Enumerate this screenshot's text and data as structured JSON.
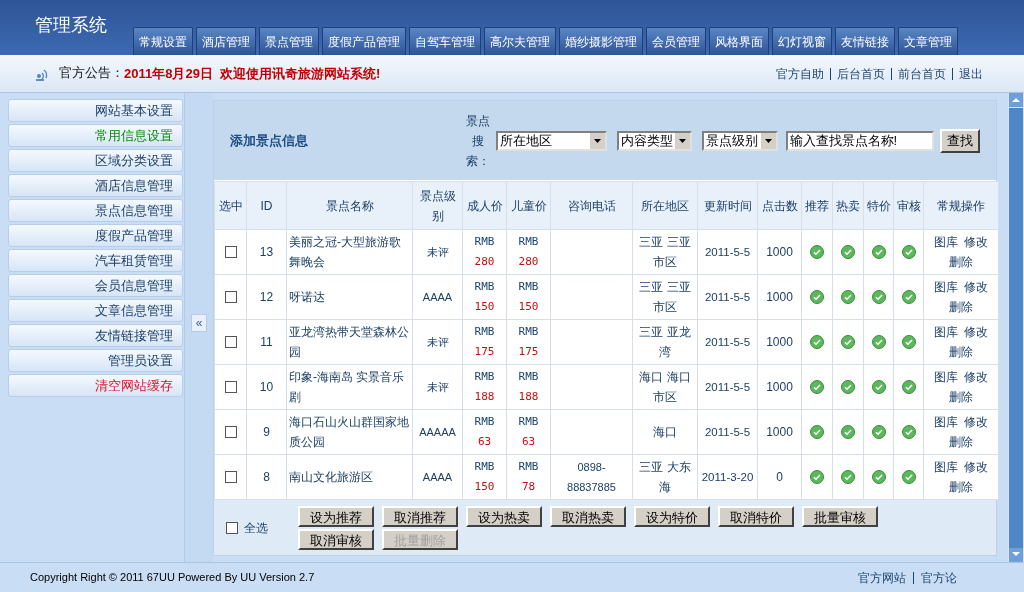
{
  "header": {
    "title": "管理系统",
    "tabs": [
      {
        "label": "常规设置"
      },
      {
        "label": "酒店管理"
      },
      {
        "label": "景点管理"
      },
      {
        "label": "度假产品管理"
      },
      {
        "label": "自驾车管理"
      },
      {
        "label": "高尔夫管理"
      },
      {
        "label": "婚纱摄影管理"
      },
      {
        "label": "会员管理"
      },
      {
        "label": "风格界面"
      },
      {
        "label": "幻灯视窗"
      },
      {
        "label": "友情链接"
      },
      {
        "label": "文章管理"
      }
    ]
  },
  "notice": {
    "label": "官方公告：",
    "text": "2011年8月29日  欢迎使用讯奇旅游网站系统!",
    "links": [
      "官方自助",
      "后台首页",
      "前台首页",
      "退出"
    ]
  },
  "sidebar": {
    "items": [
      {
        "label": "网站基本设置",
        "selected": false,
        "kind": "normal"
      },
      {
        "label": "常用信息设置",
        "selected": true,
        "kind": "normal"
      },
      {
        "label": "区域分类设置",
        "selected": false,
        "kind": "normal"
      },
      {
        "label": "酒店信息管理",
        "selected": false,
        "kind": "normal"
      },
      {
        "label": "景点信息管理",
        "selected": false,
        "kind": "normal"
      },
      {
        "label": "度假产品管理",
        "selected": false,
        "kind": "normal"
      },
      {
        "label": "汽车租赁管理",
        "selected": false,
        "kind": "normal"
      },
      {
        "label": "会员信息管理",
        "selected": false,
        "kind": "normal"
      },
      {
        "label": "文章信息管理",
        "selected": false,
        "kind": "normal"
      },
      {
        "label": "友情链接管理",
        "selected": false,
        "kind": "normal"
      },
      {
        "label": "管理员设置",
        "selected": false,
        "kind": "normal"
      },
      {
        "label": "清空网站缓存",
        "selected": false,
        "kind": "danger"
      }
    ],
    "collapse": "«"
  },
  "panel": {
    "title": "添加景点信息",
    "search": {
      "label": "景点搜索：",
      "selects": [
        "所在地区",
        "内容类型",
        "景点级别"
      ],
      "value": "输入查找景点名称!",
      "button": "查找"
    }
  },
  "table": {
    "columns": [
      "选中",
      "ID",
      "景点名称",
      "景点级别",
      "成人价",
      "儿童价",
      "咨询电话",
      "所在地区",
      "更新时间",
      "点击数",
      "推荐",
      "热卖",
      "特价",
      "审核",
      "常规操作"
    ],
    "rows": [
      {
        "checked": false,
        "id": "13",
        "name": "美丽之冠-大型旅游歌舞晚会",
        "level": "未评",
        "adult": {
          "currency": "RMB",
          "amount": "280"
        },
        "child": {
          "currency": "RMB",
          "amount": "280"
        },
        "phone": "",
        "region": "三亚 三亚市区",
        "updated": "2011-5-5",
        "clicks": "1000",
        "recommend": true,
        "hot": true,
        "special": true,
        "approved": true,
        "actions": [
          "图库",
          "修改",
          "删除"
        ]
      },
      {
        "checked": false,
        "id": "12",
        "name": "呀诺达",
        "level": "AAAA",
        "adult": {
          "currency": "RMB",
          "amount": "150"
        },
        "child": {
          "currency": "RMB",
          "amount": "150"
        },
        "phone": "",
        "region": "三亚 三亚市区",
        "updated": "2011-5-5",
        "clicks": "1000",
        "recommend": true,
        "hot": true,
        "special": true,
        "approved": true,
        "actions": [
          "图库",
          "修改",
          "删除"
        ]
      },
      {
        "checked": false,
        "id": "11",
        "name": "亚龙湾热带天堂森林公园",
        "level": "未评",
        "adult": {
          "currency": "RMB",
          "amount": "175"
        },
        "child": {
          "currency": "RMB",
          "amount": "175"
        },
        "phone": "",
        "region": "三亚 亚龙湾",
        "updated": "2011-5-5",
        "clicks": "1000",
        "recommend": true,
        "hot": true,
        "special": true,
        "approved": true,
        "actions": [
          "图库",
          "修改",
          "删除"
        ]
      },
      {
        "checked": false,
        "id": "10",
        "name": "印象-海南岛 实景音乐剧",
        "level": "未评",
        "adult": {
          "currency": "RMB",
          "amount": "188"
        },
        "child": {
          "currency": "RMB",
          "amount": "188"
        },
        "phone": "",
        "region": "海口 海口市区",
        "updated": "2011-5-5",
        "clicks": "1000",
        "recommend": true,
        "hot": true,
        "special": true,
        "approved": true,
        "actions": [
          "图库",
          "修改",
          "删除"
        ]
      },
      {
        "checked": false,
        "id": "9",
        "name": "海口石山火山群国家地质公园",
        "level": "AAAAA",
        "adult": {
          "currency": "RMB",
          "amount": "63"
        },
        "child": {
          "currency": "RMB",
          "amount": "63"
        },
        "phone": "",
        "region": "海口",
        "updated": "2011-5-5",
        "clicks": "1000",
        "recommend": true,
        "hot": true,
        "special": true,
        "approved": true,
        "actions": [
          "图库",
          "修改",
          "删除"
        ]
      },
      {
        "checked": false,
        "id": "8",
        "name": "南山文化旅游区",
        "level": "AAAA",
        "adult": {
          "currency": "RMB",
          "amount": "150"
        },
        "child": {
          "currency": "RMB",
          "amount": "78"
        },
        "phone": "0898-88837885",
        "region": "三亚 大东海",
        "updated": "2011-3-20",
        "clicks": "0",
        "recommend": true,
        "hot": true,
        "special": true,
        "approved": true,
        "actions": [
          "图库",
          "修改",
          "删除"
        ]
      }
    ]
  },
  "bulk": {
    "select_all": {
      "label": "全选",
      "checked": false
    },
    "buttons": [
      {
        "label": "设为推荐",
        "disabled": false
      },
      {
        "label": "取消推荐",
        "disabled": false
      },
      {
        "label": "设为热卖",
        "disabled": false
      },
      {
        "label": "取消热卖",
        "disabled": false
      },
      {
        "label": "设为特价",
        "disabled": false
      },
      {
        "label": "取消特价",
        "disabled": false
      },
      {
        "label": "批量审核",
        "disabled": false
      },
      {
        "label": "取消审核",
        "disabled": false
      },
      {
        "label": "批量删除",
        "disabled": true
      }
    ]
  },
  "footer": {
    "copyright": "Copyright Right © 2011 67UU Powered By UU Version 2.7",
    "links": [
      "官方网站",
      "官方论"
    ]
  }
}
